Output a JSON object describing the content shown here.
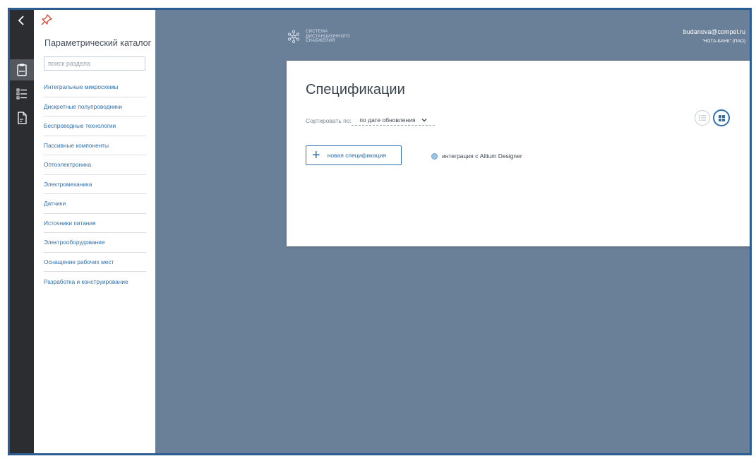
{
  "rail": {
    "back_icon": "chevron-left-icon",
    "items": [
      {
        "icon": "clipboard-icon",
        "active": true
      },
      {
        "icon": "list-icon",
        "active": false
      },
      {
        "icon": "document-icon",
        "active": false
      }
    ]
  },
  "catalog": {
    "pin_icon": "pin-icon",
    "title": "Параметрический каталог",
    "search_placeholder": "поиск раздела",
    "items": [
      "Интегральные микросхемы",
      "Дискретные полупроводники",
      "Беспроводные технологии",
      "Пассивные компоненты",
      "Оптоэлектроника",
      "Электромеханика",
      "Датчики",
      "Источники питания",
      "Электрооборудование",
      "Оснащение рабочих мест",
      "Разработка и конструирование"
    ]
  },
  "header": {
    "logo_lines": [
      "СИСТЕМА",
      "ДИСТАНЦИОННОГО",
      "СНАБЖЕНИЯ"
    ],
    "user_email": "budanova@compel.ru",
    "user_org": "\"НОТА-БАНК\" (ПАО)"
  },
  "specs": {
    "title": "Спецификации",
    "sort_label": "Сортировать по:",
    "sort_value": "по дате обновления",
    "new_button_label": "новая спецификация",
    "altium_label": "интеграция с Altium Designer"
  },
  "colors": {
    "accent": "#2f6fae",
    "background": "#6a7f98",
    "rail": "#2b2d31",
    "frame_border": "#2b5d93"
  }
}
